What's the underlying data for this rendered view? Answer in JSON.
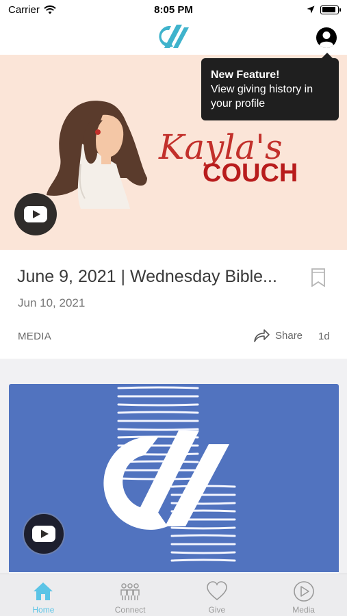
{
  "status_bar": {
    "carrier": "Carrier",
    "time": "8:05 PM",
    "battery_level": 0.9
  },
  "header": {
    "logo_icon": "church-logo-icon",
    "profile_icon": "profile-icon"
  },
  "tooltip": {
    "title": "New Feature!",
    "body": "View giving history in your profile"
  },
  "feed": {
    "cards": [
      {
        "banner_script": "Kayla's",
        "banner_heading": "COUCH",
        "title": "June 9, 2021 | Wednesday Bible...",
        "date": "Jun 10, 2021",
        "category": "MEDIA",
        "share_label": "Share",
        "age": "1d",
        "play_icon": "youtube-play-icon"
      },
      {
        "play_icon": "youtube-play-icon"
      }
    ]
  },
  "tab_bar": {
    "tabs": [
      {
        "label": "Home",
        "icon": "home-icon",
        "active": true
      },
      {
        "label": "Connect",
        "icon": "people-icon",
        "active": false
      },
      {
        "label": "Give",
        "icon": "heart-icon",
        "active": false
      },
      {
        "label": "Media",
        "icon": "play-circle-icon",
        "active": false
      }
    ]
  },
  "colors": {
    "accent": "#5bc4e6",
    "logo": "#3fb3cc",
    "tooltip_bg": "#1f1f1f",
    "banner_peach": "#fbe5d8",
    "banner_red": "#b81c1c",
    "banner_blue": "#5173bf"
  }
}
